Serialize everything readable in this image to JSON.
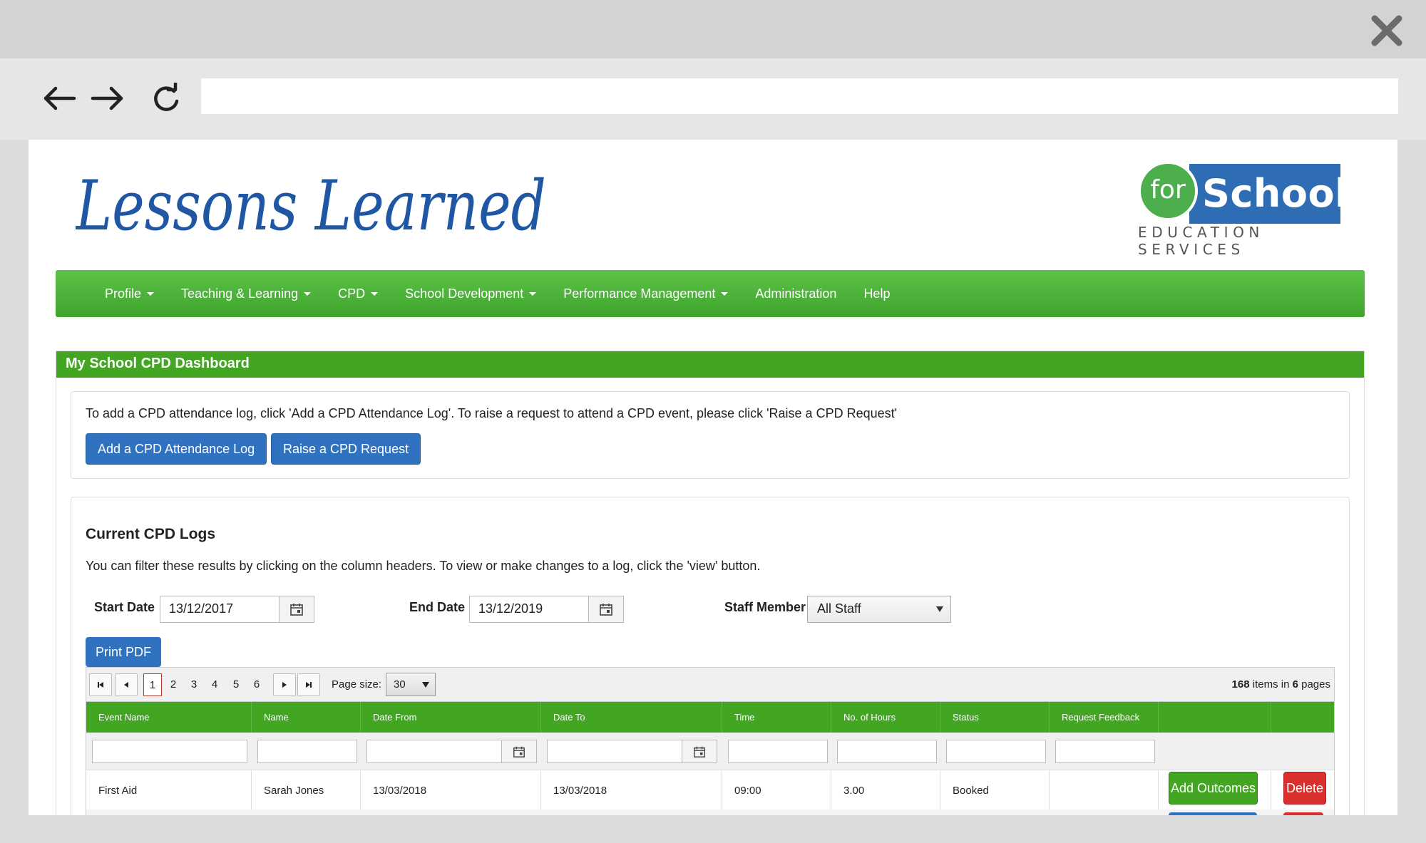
{
  "brand": {
    "lessons_learned": "Lessons Learned",
    "for": "for",
    "schools": "Schools",
    "education_services": "EDUCATION SERVICES"
  },
  "nav": {
    "items": [
      {
        "label": "Profile",
        "dropdown": true
      },
      {
        "label": "Teaching & Learning",
        "dropdown": true
      },
      {
        "label": "CPD",
        "dropdown": true
      },
      {
        "label": "School Development",
        "dropdown": true
      },
      {
        "label": "Performance Management",
        "dropdown": true
      },
      {
        "label": "Administration",
        "dropdown": false
      },
      {
        "label": "Help",
        "dropdown": false
      }
    ]
  },
  "panel": {
    "title": "My School CPD Dashboard",
    "intro": "To add a CPD attendance log, click 'Add a CPD Attendance Log'. To raise a request to attend a CPD event, please click 'Raise a CPD Request'",
    "add_log_label": "Add a CPD Attendance Log",
    "raise_request_label": "Raise a CPD Request"
  },
  "logs": {
    "title": "Current CPD Logs",
    "description": "You can filter these results by clicking on the column headers. To view or make changes to a log, click the 'view' button.",
    "start_date_label": "Start Date",
    "start_date_value": "13/12/2017",
    "end_date_label": "End Date",
    "end_date_value": "13/12/2019",
    "staff_label": "Staff Member",
    "staff_value": "All Staff",
    "print_pdf_label": "Print PDF"
  },
  "pager": {
    "pages": [
      "1",
      "2",
      "3",
      "4",
      "5",
      "6"
    ],
    "current_page": "1",
    "page_size_label": "Page size:",
    "page_size_value": "30",
    "info_count": "168",
    "info_items_in": "items in",
    "info_pages_count": "6",
    "info_pages": "pages"
  },
  "grid": {
    "columns": [
      "Event Name",
      "Name",
      "Date From",
      "Date To",
      "Time",
      "No. of Hours",
      "Status",
      "Request Feedback",
      "",
      ""
    ],
    "rows": [
      {
        "event_name": "First Aid",
        "name": "Sarah Jones",
        "date_from": "13/03/2018",
        "date_to": "13/03/2018",
        "time": "09:00",
        "hours": "3.00",
        "status": "Booked",
        "request_feedback": "",
        "outcomes_label": "Add Outcomes",
        "delete_label": "Delete"
      }
    ]
  },
  "colors": {
    "nav_green": "#4cb43a",
    "header_green": "#43a623",
    "button_blue": "#2f73c0",
    "danger_red": "#d9302e",
    "brand_blue": "#2e6db4"
  }
}
